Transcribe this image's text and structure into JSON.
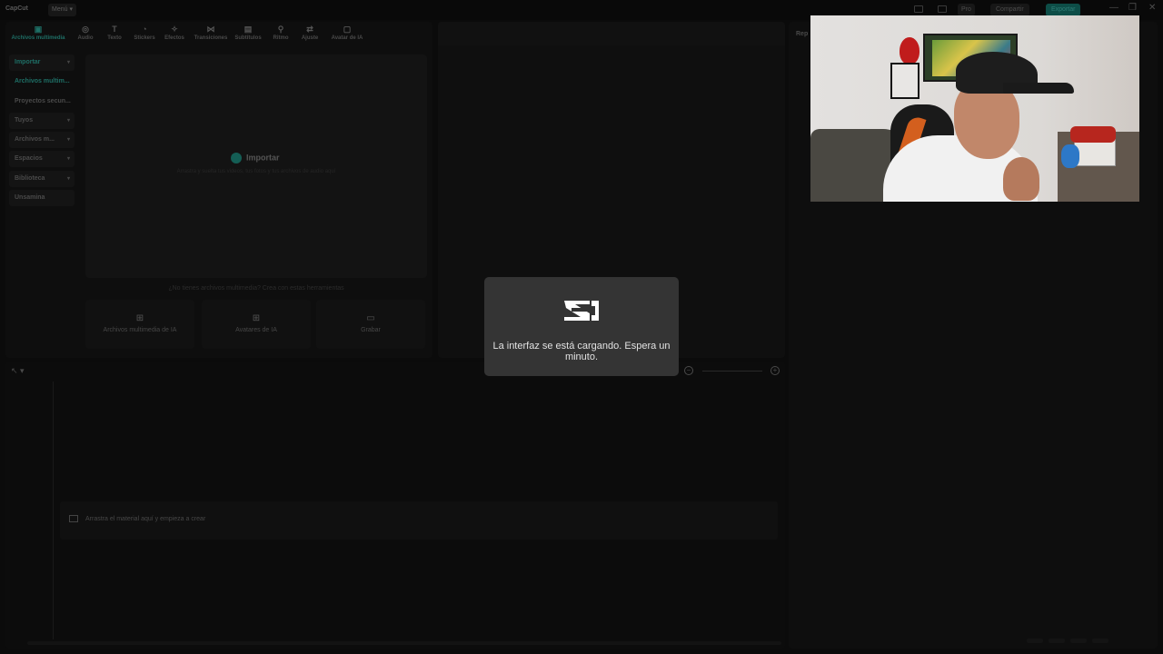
{
  "titlebar": {
    "app_name": "CapCut",
    "menu_label": "Menú ▾",
    "pro_label": "Pro",
    "share_label": "Compartir",
    "export_label": "Exportar",
    "minimize_glyph": "—",
    "restore_glyph": "❐",
    "close_glyph": "✕"
  },
  "toolbar": {
    "items": [
      {
        "label": "Archivos multimedia",
        "icon": "media-icon",
        "glyph": "▣"
      },
      {
        "label": "Audio",
        "icon": "audio-icon",
        "glyph": "◎"
      },
      {
        "label": "Texto",
        "icon": "text-icon",
        "glyph": "T"
      },
      {
        "label": "Stickers",
        "icon": "sticker-icon",
        "glyph": "◔"
      },
      {
        "label": "Efectos",
        "icon": "effects-icon",
        "glyph": "✧"
      },
      {
        "label": "Transiciones",
        "icon": "transitions-icon",
        "glyph": "⋈"
      },
      {
        "label": "Subtítulos",
        "icon": "subtitles-icon",
        "glyph": "▤"
      },
      {
        "label": "Ritmo",
        "icon": "rhythm-icon",
        "glyph": "⚲"
      },
      {
        "label": "Ajuste",
        "icon": "adjust-icon",
        "glyph": "⇄"
      },
      {
        "label": "Avatar de IA",
        "icon": "ai-avatar-icon",
        "glyph": "▢"
      }
    ]
  },
  "sidenav": {
    "items": [
      {
        "label": "Importar"
      },
      {
        "label": "Archivos multim..."
      },
      {
        "label": "Proyectos secun..."
      },
      {
        "label": "Tuyos"
      },
      {
        "label": "Archivos m..."
      },
      {
        "label": "Espacios"
      },
      {
        "label": "Biblioteca"
      },
      {
        "label": "Unsamina"
      }
    ],
    "chevron": "▾"
  },
  "import": {
    "label": "Importar",
    "hint": "Arrastra y suelta tus videos, tus fotos y tus archivos de audio aquí",
    "no_files": "¿No tienes archivos multimedia? Crea con estas herramientas"
  },
  "cards": [
    {
      "label": "Archivos multimedia de IA",
      "glyph": "⊞"
    },
    {
      "label": "Avatares de IA",
      "glyph": "⊞"
    },
    {
      "label": "Grabar",
      "glyph": "▭"
    }
  ],
  "right_panel": {
    "label": "Rep"
  },
  "timeline": {
    "cursor_glyph": "↖ ▾",
    "zoom_minus": "−",
    "zoom_plus": "+",
    "drop_label": "Arrastra el material aquí y empieza a crear"
  },
  "modal": {
    "message": "La interfaz se está cargando. Espera un minuto."
  },
  "colors": {
    "accent": "#1e6f66",
    "modal_bg": "#343434"
  }
}
